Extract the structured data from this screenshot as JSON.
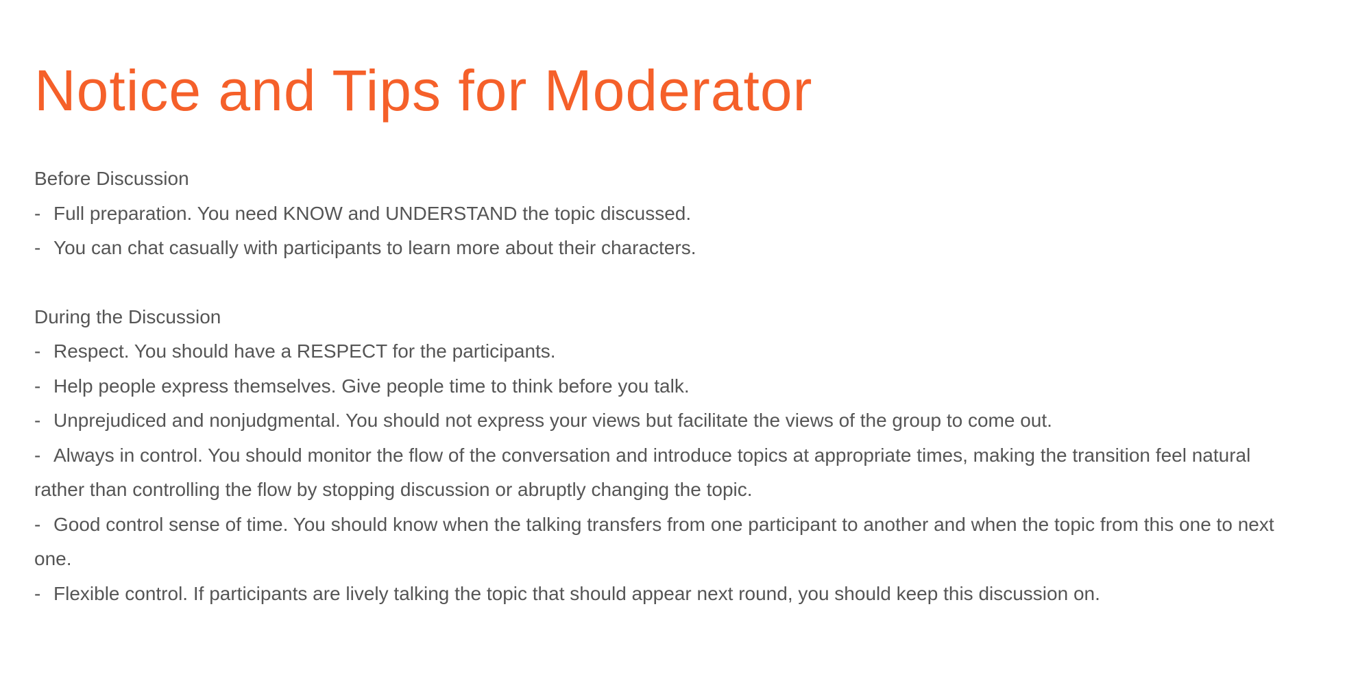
{
  "title": "Notice and Tips for Moderator",
  "accent_color": "#F5602A",
  "text_color": "#555555",
  "sections": [
    {
      "heading": "Before Discussion",
      "items": [
        "Full preparation. You need KNOW and UNDERSTAND the topic discussed.",
        "You can chat casually with participants to learn more about their characters."
      ]
    },
    {
      "heading": "During the Discussion",
      "items": [
        "Respect. You should have a RESPECT for the participants.",
        "Help people express themselves. Give people time to think before you talk.",
        "Unprejudiced and nonjudgmental. You should not express your views but facilitate the views of the group to come out.",
        "Always in control. You should monitor the flow of the conversation and introduce topics at appropriate times, making the transition feel natural rather than controlling the flow by stopping discussion or abruptly changing the topic.",
        "Good control sense of time. You should know when the talking transfers from one participant to another and when the topic from this one to next one.",
        "Flexible control. If participants are lively talking the topic that should appear next round, you should keep this discussion on."
      ]
    }
  ],
  "dash": "-"
}
